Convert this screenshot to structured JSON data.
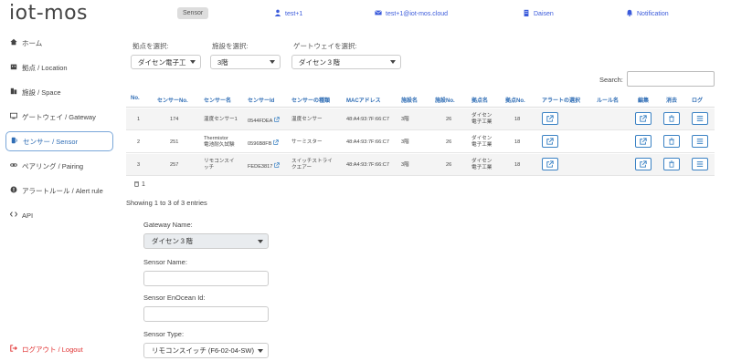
{
  "header": {
    "logo": "iot-mos",
    "active_tab": "Sensor",
    "user": "test+1",
    "email": "test+1@iot-mos.cloud",
    "org": "Daisen",
    "notification": "Notification"
  },
  "sidebar": {
    "items": [
      {
        "label": "ホーム",
        "icon": "home-icon"
      },
      {
        "label": "拠点 / Location",
        "icon": "building-icon"
      },
      {
        "label": "施設 / Space",
        "icon": "space-icon"
      },
      {
        "label": "ゲートウェイ / Gateway",
        "icon": "gateway-icon"
      },
      {
        "label": "センサー / Sensor",
        "icon": "sensor-icon"
      },
      {
        "label": "ペアリング / Pairing",
        "icon": "link-icon"
      },
      {
        "label": "アラートルール / Alert rule",
        "icon": "alert-icon"
      },
      {
        "label": "API",
        "icon": "code-icon"
      }
    ],
    "logout": "ログアウト / Logout"
  },
  "filters": {
    "location_label": "拠点を選択:",
    "location_value": "ダイセン電子工",
    "space_label": "施設を選択:",
    "space_value": "3階",
    "gateway_label": "ゲートウェイを選択:",
    "gateway_value": "ダイセン３階",
    "search_label": "Search:"
  },
  "table": {
    "headers": [
      "No.",
      "センサーNo.",
      "センサー名",
      "センサーId",
      "センサーの種類",
      "MACアドレス",
      "施設名",
      "施設No.",
      "拠点名",
      "拠点No.",
      "アラートの選択",
      "ルール名",
      "編集",
      "消去",
      "ログ"
    ],
    "rows": [
      {
        "no": "1",
        "sensor_no": "174",
        "name1": "温度センサー1",
        "name2": "",
        "id": "0544FDEA",
        "type1": "温度センサー",
        "type2": "",
        "mac": "48:A4:93:7F:66:C7",
        "space": "3階",
        "space_no": "26",
        "loc1": "ダイセン",
        "loc2": "電子工業",
        "loc_no": "18"
      },
      {
        "no": "2",
        "sensor_no": "251",
        "name1": "Thermistor",
        "name2": "電池耐久試験",
        "id": "0596B8FB",
        "type1": "サーミスター",
        "type2": "",
        "mac": "48:A4:93:7F:66:C7",
        "space": "3階",
        "space_no": "26",
        "loc1": "ダイセン",
        "loc2": "電子工業",
        "loc_no": "18"
      },
      {
        "no": "3",
        "sensor_no": "257",
        "name1": "リモコンスイ",
        "name2": "ッチ",
        "id": "FEDE3817",
        "type1": "スイッチストライ",
        "type2": "クエアー",
        "mac": "48:A4:93:7F:66:C7",
        "space": "3階",
        "space_no": "26",
        "loc1": "ダイセン",
        "loc2": "電子工業",
        "loc_no": "18"
      }
    ],
    "footer_count": "1",
    "showing": "Showing 1 to 3 of 3 entries"
  },
  "form": {
    "gateway_label": "Gateway Name:",
    "gateway_value": "ダイセン３階",
    "sensor_name_label": "Sensor Name:",
    "enocean_label": "Sensor EnOcean Id:",
    "type_label": "Sensor Type:",
    "type_value": "リモコンスイッチ (F6-02-04-SW)"
  },
  "colors": {
    "accent": "#3b82c4",
    "danger": "#e03131",
    "header_text": "#3b5bdb"
  }
}
